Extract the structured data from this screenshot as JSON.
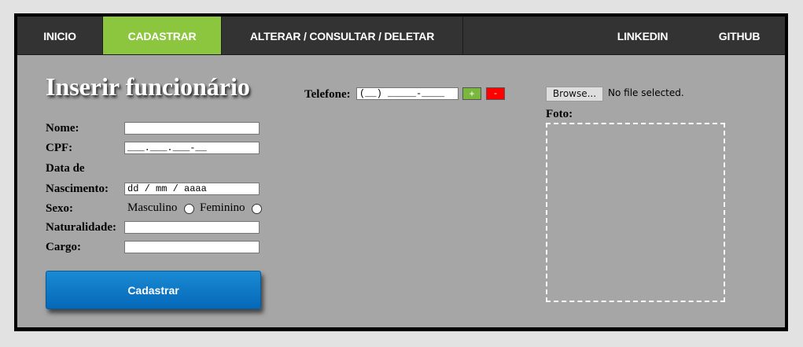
{
  "nav": {
    "items": [
      "INICIO",
      "CADASTRAR",
      "ALTERAR / CONSULTAR / DELETAR",
      "LINKEDIN",
      "GITHUB"
    ],
    "active_index": 1
  },
  "form": {
    "title": "Inserir funcionário",
    "labels": {
      "nome": "Nome:",
      "cpf": "CPF:",
      "data1": "Data de",
      "data2": "Nascimento:",
      "sexo": "Sexo:",
      "naturalidade": "Naturalidade:",
      "cargo": "Cargo:",
      "telefone": "Telefone:",
      "foto": "Foto:"
    },
    "fields": {
      "nome": "",
      "cpf_mask": "___.___.___-__",
      "nascimento_placeholder": "dd / mm / aaaa",
      "naturalidade": "",
      "cargo": "",
      "telefone_mask": "(__) _____-____"
    },
    "sexo_options": [
      "Masculino",
      "Feminino"
    ],
    "buttons": {
      "plus": "+",
      "minus": "-",
      "cadastrar": "Cadastrar",
      "browse": "Browse..."
    },
    "file_status": "No file selected."
  },
  "colors": {
    "nav_bg": "#333333",
    "nav_active": "#8cc63f",
    "content_bg": "#a6a6a6",
    "primary_button": "#0a74c4",
    "plus": "#7ab83d",
    "minus": "#ff0000"
  }
}
